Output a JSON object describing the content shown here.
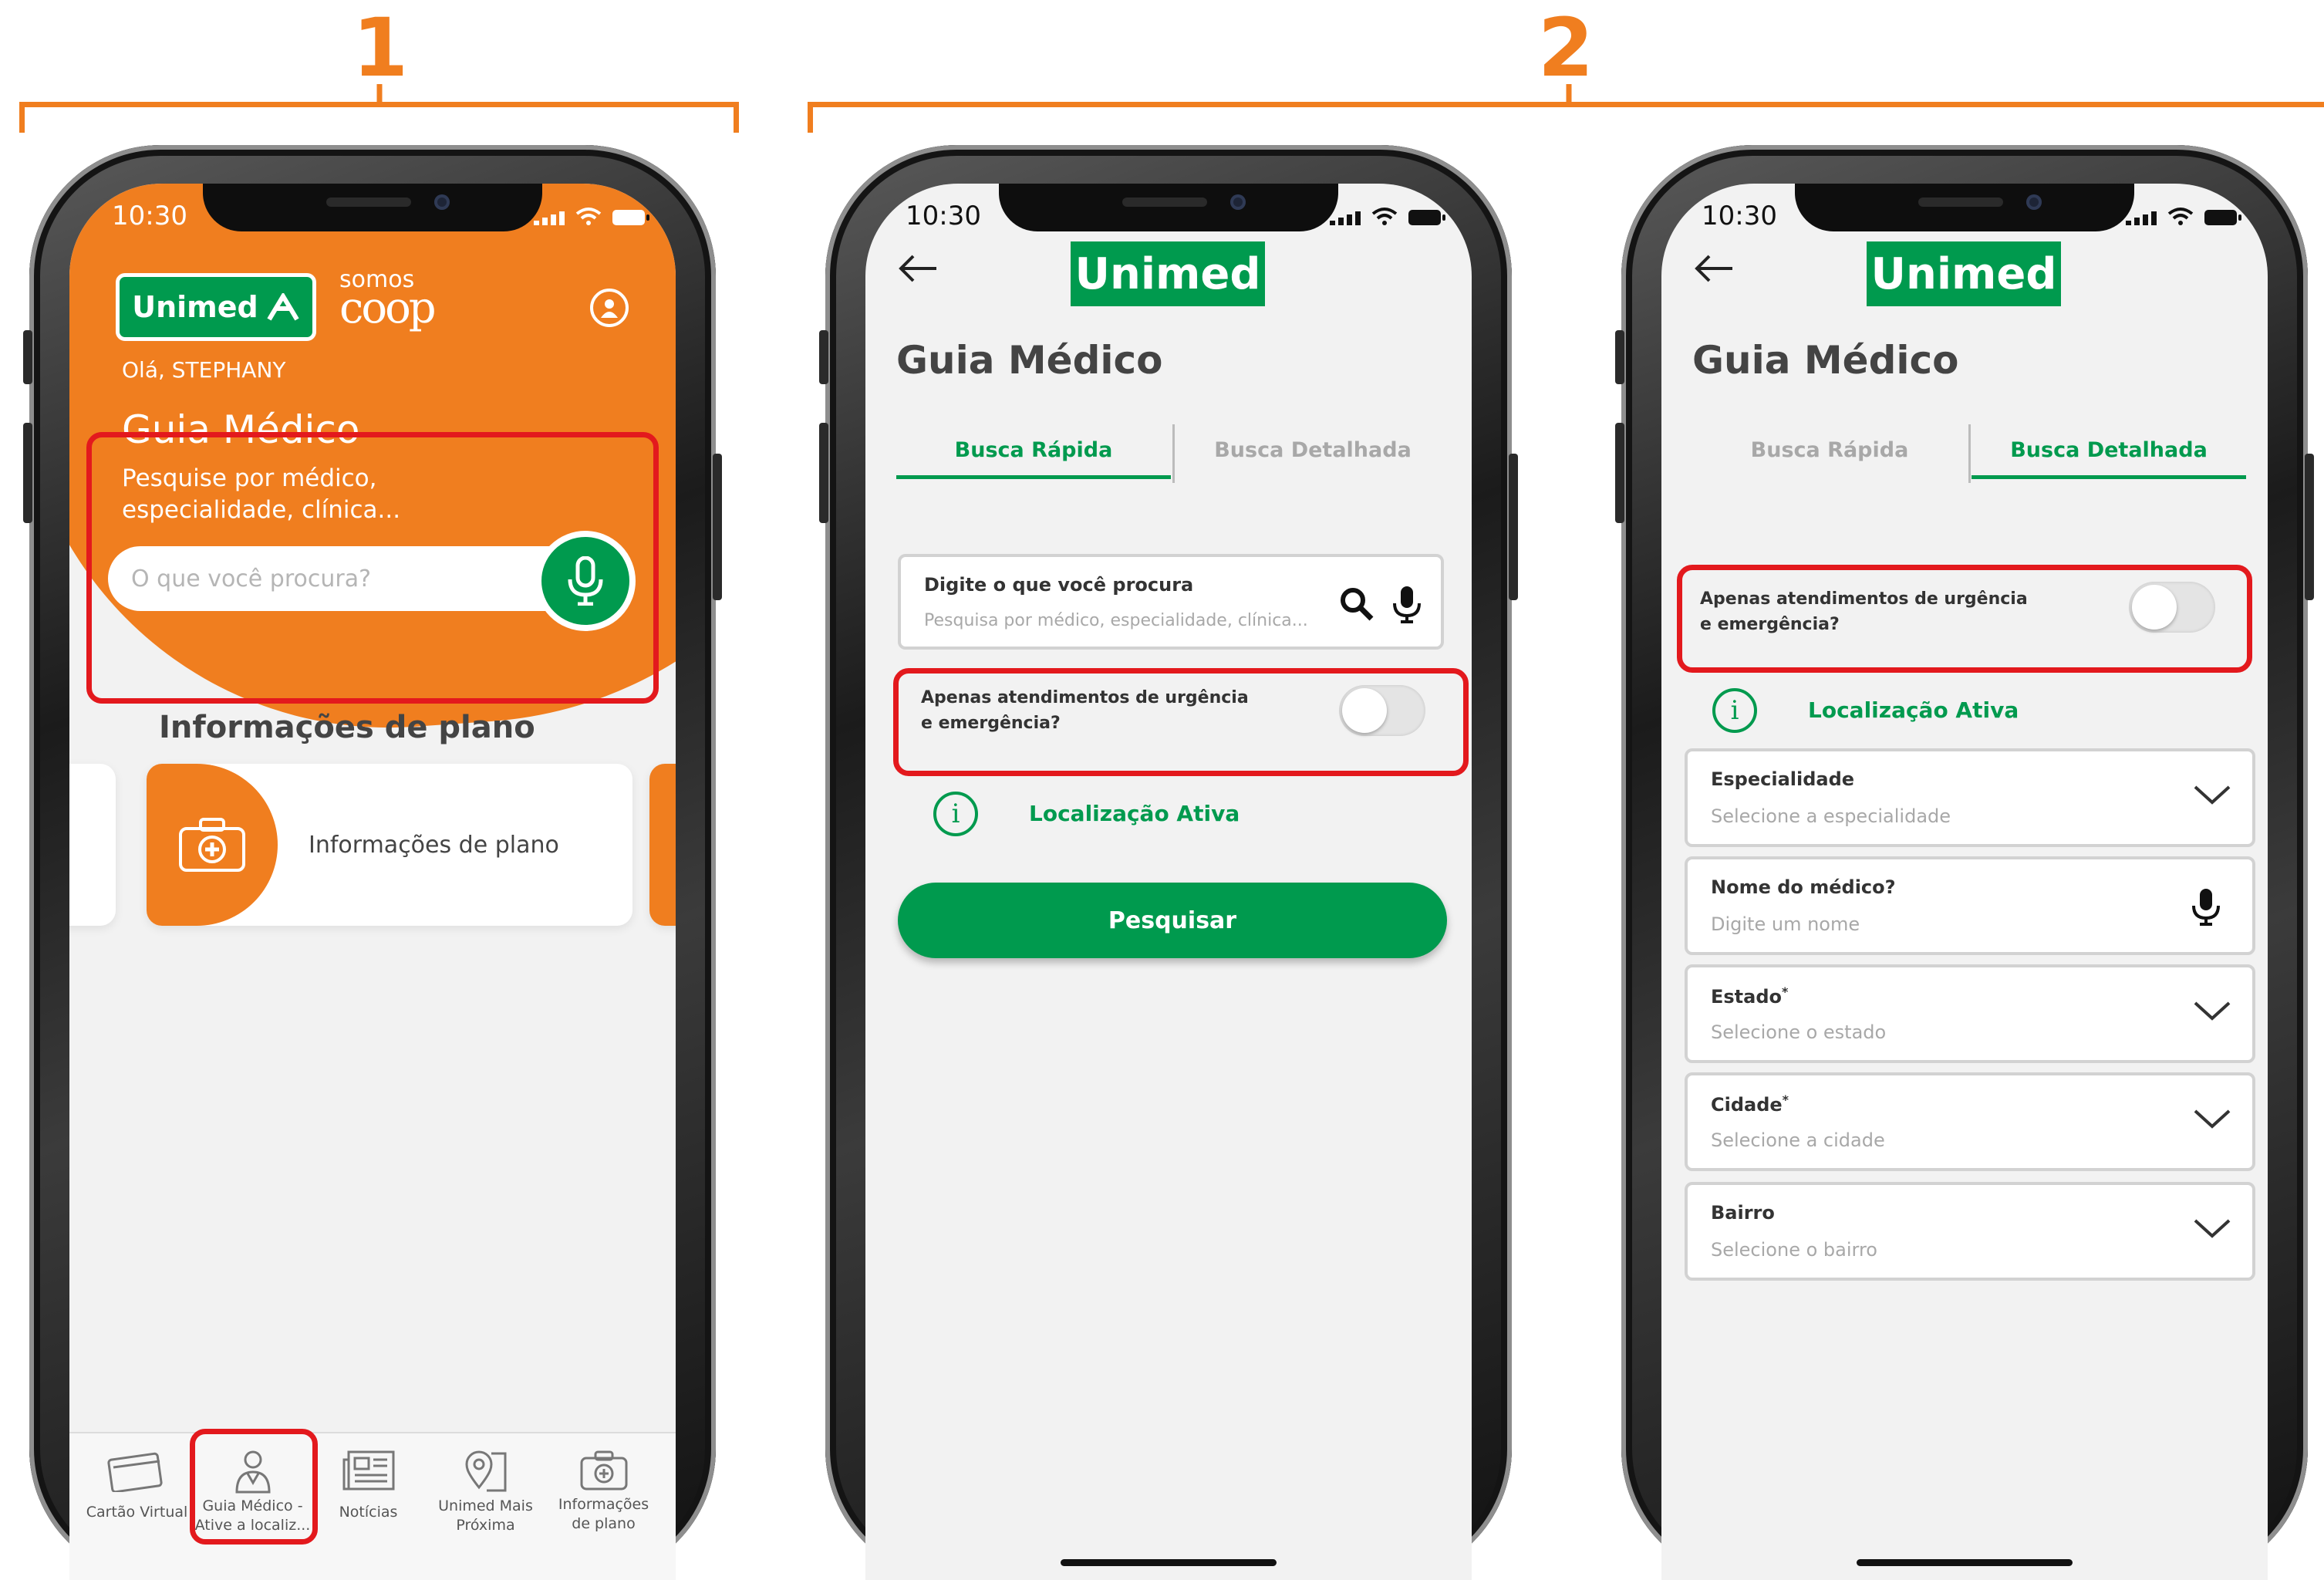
{
  "steps": [
    "1",
    "2"
  ],
  "colors": {
    "orange": "#f07e1f",
    "green": "#009a4e",
    "red": "#e3191d"
  },
  "status_time": "10:30",
  "phone1": {
    "brand": "Unimed",
    "somos": "somos",
    "coop": "coop",
    "greeting": "Olá, STEPHANY",
    "hero_title": "Guia Médico",
    "hero_subtitle": "Pesquise por médico, especialidade, clínica...",
    "search_placeholder": "O que você procura?",
    "section_title": "Informações de plano",
    "card_label": "Informações de plano",
    "nav": [
      {
        "label": "Cartão Virtual",
        "icon": "card-icon"
      },
      {
        "label": "Guia Médico - Ative a localiz...",
        "icon": "doctor-icon"
      },
      {
        "label": "Notícias",
        "icon": "newspaper-icon"
      },
      {
        "label": "Unimed Mais Próxima",
        "icon": "map-pin-icon"
      },
      {
        "label": "Informações de plano",
        "icon": "medical-kit-icon"
      }
    ]
  },
  "phone2": {
    "logo": "Unimed",
    "title": "Guia Médico",
    "tabs": [
      "Busca Rápida",
      "Busca Detalhada"
    ],
    "search_label": "Digite o que você procura",
    "search_placeholder": "Pesquisa por médico, especialidade, clínica...",
    "toggle_label": "Apenas atendimentos de urgência e emergência?",
    "location": "Localização Ativa",
    "button": "Pesquisar"
  },
  "phone3": {
    "logo": "Unimed",
    "title": "Guia Médico",
    "tabs": [
      "Busca Rápida",
      "Busca Detalhada"
    ],
    "toggle_label": "Apenas atendimentos de urgência e emergência?",
    "location": "Localização Ativa",
    "fields": [
      {
        "label": "Especialidade",
        "placeholder": "Selecione a especialidade",
        "required": "",
        "control": "chevron"
      },
      {
        "label": "Nome do médico?",
        "placeholder": "Digite um nome",
        "required": "",
        "control": "mic"
      },
      {
        "label": "Estado",
        "placeholder": "Selecione o estado",
        "required": "*",
        "control": "chevron"
      },
      {
        "label": "Cidade",
        "placeholder": "Selecione a cidade",
        "required": "*",
        "control": "chevron"
      },
      {
        "label": "Bairro",
        "placeholder": "Selecione o bairro",
        "required": "",
        "control": "chevron"
      }
    ]
  }
}
